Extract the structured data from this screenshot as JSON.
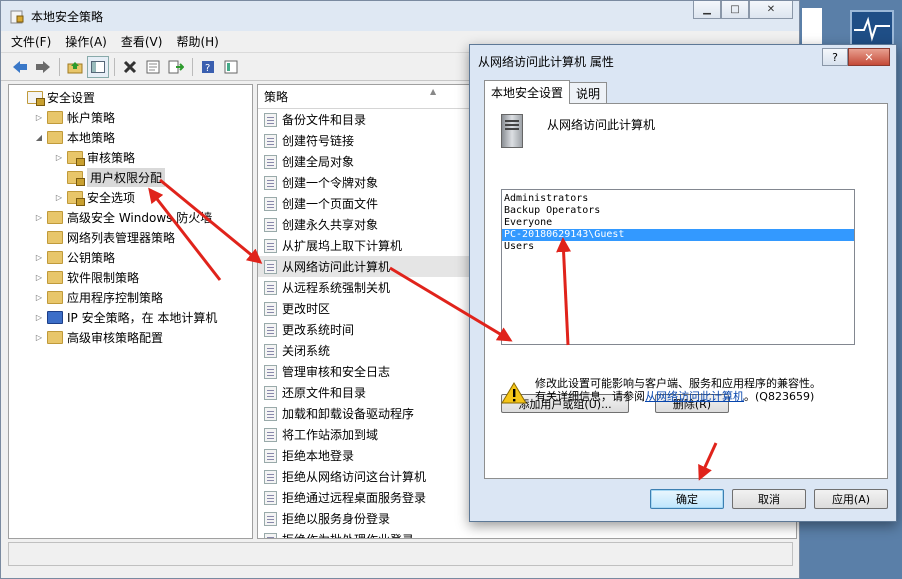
{
  "main_window": {
    "title": "本地安全策略",
    "menu": [
      "文件(F)",
      "操作(A)",
      "查看(V)",
      "帮助(H)"
    ],
    "tree": [
      {
        "label": "安全设置",
        "level": 0,
        "arrow": "",
        "type": "root"
      },
      {
        "label": "帐户策略",
        "level": 1,
        "arrow": "▷",
        "type": "folder"
      },
      {
        "label": "本地策略",
        "level": 1,
        "arrow": "◢",
        "type": "folder"
      },
      {
        "label": "审核策略",
        "level": 2,
        "arrow": "▷",
        "type": "folder"
      },
      {
        "label": "用户权限分配",
        "level": 2,
        "arrow": "",
        "type": "folder",
        "selected": true
      },
      {
        "label": "安全选项",
        "level": 2,
        "arrow": "▷",
        "type": "folder"
      },
      {
        "label": "高级安全 Windows 防火墙",
        "level": 1,
        "arrow": "▷",
        "type": "folder"
      },
      {
        "label": "网络列表管理器策略",
        "level": 1,
        "arrow": "",
        "type": "folder"
      },
      {
        "label": "公钥策略",
        "level": 1,
        "arrow": "▷",
        "type": "folder"
      },
      {
        "label": "软件限制策略",
        "level": 1,
        "arrow": "▷",
        "type": "folder"
      },
      {
        "label": "应用程序控制策略",
        "level": 1,
        "arrow": "▷",
        "type": "folder"
      },
      {
        "label": "IP 安全策略，在 本地计算机",
        "level": 1,
        "arrow": "▷",
        "type": "ipsec"
      },
      {
        "label": "高级审核策略配置",
        "level": 1,
        "arrow": "▷",
        "type": "folder"
      }
    ],
    "column_header": "策略",
    "policies": [
      "备份文件和目录",
      "创建符号链接",
      "创建全局对象",
      "创建一个令牌对象",
      "创建一个页面文件",
      "创建永久共享对象",
      "从扩展坞上取下计算机",
      "从网络访问此计算机",
      "从远程系统强制关机",
      "更改时区",
      "更改系统时间",
      "关闭系统",
      "管理审核和安全日志",
      "还原文件和目录",
      "加载和卸载设备驱动程序",
      "将工作站添加到域",
      "拒绝本地登录",
      "拒绝从网络访问这台计算机",
      "拒绝通过远程桌面服务登录",
      "拒绝以服务身份登录",
      "拒绝作为批处理作业登录"
    ],
    "highlighted_policy_index": 7
  },
  "dialog": {
    "title": "从网络访问此计算机 属性",
    "help": "?",
    "close": "✕",
    "tabs": [
      "本地安全设置",
      "说明"
    ],
    "policy_name": "从网络访问此计算机",
    "accounts": [
      "Administrators",
      "Backup Operators",
      "Everyone",
      "PC-20180629143\\Guest",
      "Users"
    ],
    "selected_account_index": 3,
    "add_button": "添加用户或组(U)...",
    "remove_button": "删除(R)",
    "warning_line1": "修改此设置可能影响与客户端、服务和应用程序的兼容性。",
    "warning_line2_prefix": "有关详细信息，请参阅",
    "warning_link": "从网络访问此计算机",
    "warning_kb": "。(Q823659)",
    "ok": "确定",
    "cancel": "取消",
    "apply": "应用(A)"
  },
  "colors": {
    "arrow": "#e0231b",
    "selection": "#3399ff",
    "dialog_frame": "#dbe6f4"
  }
}
